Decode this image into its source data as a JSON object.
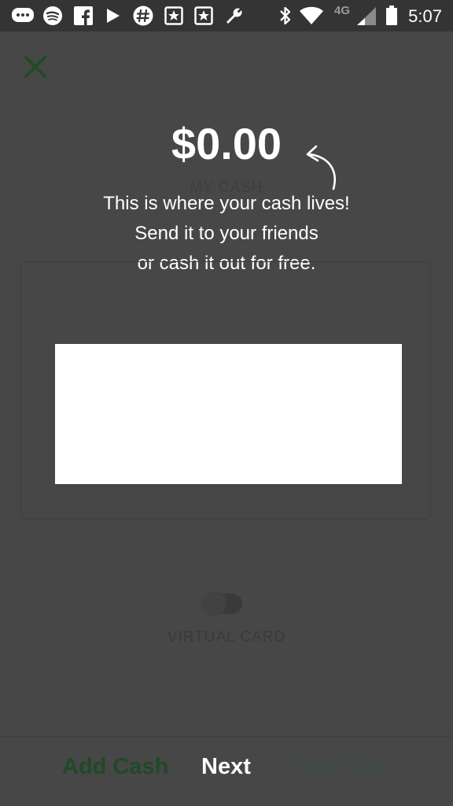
{
  "status_bar": {
    "time": "5:07",
    "network": "4G"
  },
  "balance": {
    "amount": "$0.00",
    "label": "MY CASH"
  },
  "coach": {
    "line1": "This is where your cash lives!",
    "line2": "Send it to your friends",
    "line3": "or cash it out for free."
  },
  "virtual_card": {
    "label": "VIRTUAL CARD"
  },
  "bottom": {
    "add_cash": "Add Cash",
    "next": "Next",
    "cash_out": "Cash Out"
  },
  "colors": {
    "background": "#474747",
    "accent_green": "#1f4a26",
    "overlay_text": "#ffffff"
  }
}
